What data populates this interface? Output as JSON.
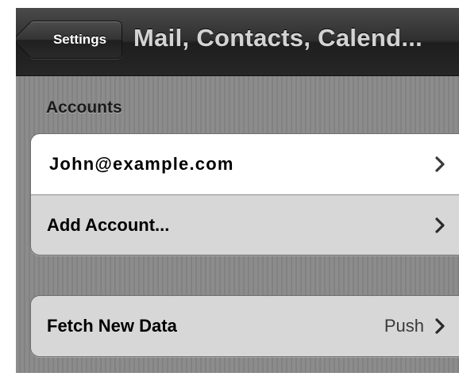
{
  "navbar": {
    "back_label": "Settings",
    "title": "Mail, Contacts, Calend..."
  },
  "accounts_section": {
    "header": "Accounts",
    "items": [
      {
        "label": "John@example.com",
        "icon": "chevron-right-icon"
      },
      {
        "label": "Add Account...",
        "icon": "chevron-right-icon"
      }
    ]
  },
  "fetch_section": {
    "label": "Fetch New Data",
    "value": "Push",
    "icon": "chevron-right-icon"
  },
  "colors": {
    "navbar": "#2f2f2f",
    "background": "#8a8a8a",
    "cell_selected": "#ffffff",
    "cell": "#d7d7d7"
  }
}
